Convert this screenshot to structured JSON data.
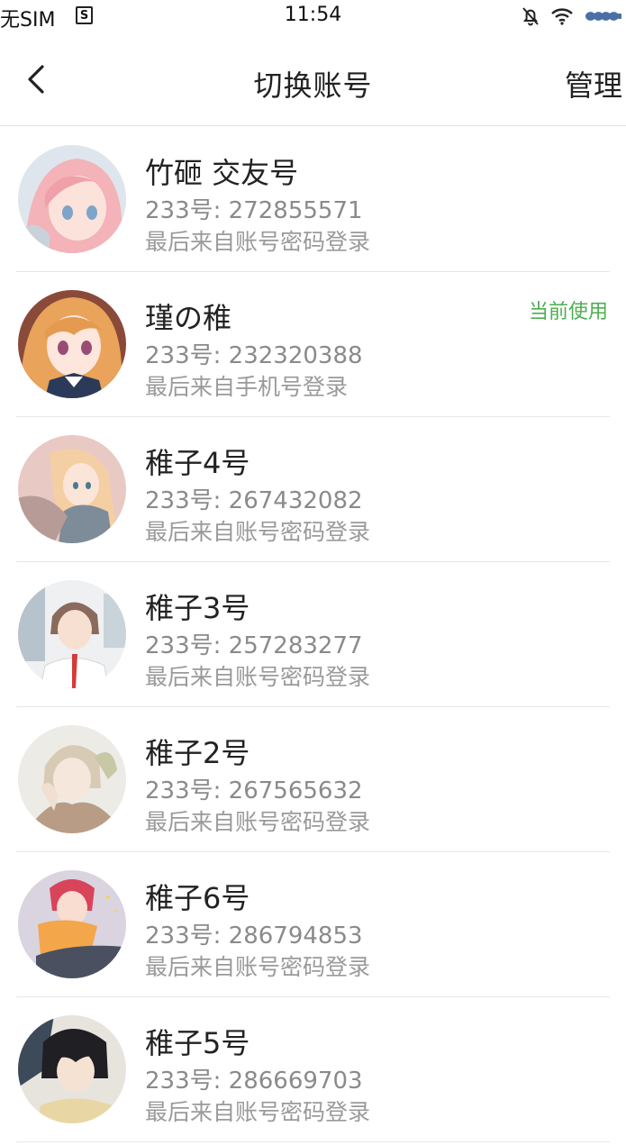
{
  "status_bar": {
    "carrier": "无SIM",
    "sim_icon_text": "S",
    "time": "11:54",
    "icons": [
      "sim-card-icon",
      "mute-bell-icon",
      "wifi-icon",
      "battery-icon"
    ]
  },
  "nav": {
    "back_icon": "chevron-left-icon",
    "title": "切换账号",
    "manage_label": "管理"
  },
  "accounts": [
    {
      "name": "竹砸 交友号",
      "uid": "233号: 272855571",
      "login": "最后来自账号密码登录",
      "badge": ""
    },
    {
      "name": "瑾の稚",
      "uid": "233号: 232320388",
      "login": "最后来自手机号登录",
      "badge": "当前使用"
    },
    {
      "name": "稚子4号",
      "uid": "233号: 267432082",
      "login": "最后来自账号密码登录",
      "badge": ""
    },
    {
      "name": "稚子3号",
      "uid": "233号: 257283277",
      "login": "最后来自账号密码登录",
      "badge": ""
    },
    {
      "name": "稚子2号",
      "uid": "233号: 267565632",
      "login": "最后来自账号密码登录",
      "badge": ""
    },
    {
      "name": "稚子6号",
      "uid": "233号: 286794853",
      "login": "最后来自账号密码登录",
      "badge": ""
    },
    {
      "name": "稚子5号",
      "uid": "233号: 286669703",
      "login": "最后来自账号密码登录",
      "badge": ""
    }
  ],
  "colors": {
    "accent_green": "#4caf50",
    "text_primary": "#222222",
    "text_secondary": "#8a8a8a",
    "divider": "#e6e6e6"
  }
}
